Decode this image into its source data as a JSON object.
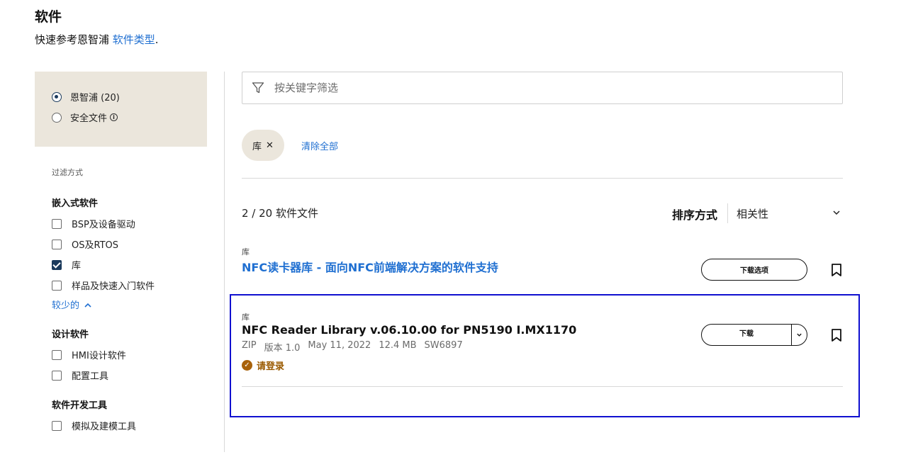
{
  "header": {
    "title": "软件",
    "subtitle_prefix": "快速参考恩智浦 ",
    "subtitle_link": "软件类型",
    "subtitle_suffix": "."
  },
  "source_filter": [
    {
      "label": "恩智浦 (20)",
      "checked": true
    },
    {
      "label": "安全文件",
      "checked": false,
      "info": "i"
    }
  ],
  "sidebar": {
    "filter_by": "过滤方式",
    "groups": [
      {
        "title": "嵌入式软件",
        "items": [
          {
            "label": "BSP及设备驱动",
            "checked": false
          },
          {
            "label": "OS及RTOS",
            "checked": false
          },
          {
            "label": "库",
            "checked": true
          },
          {
            "label": "样品及快速入门软件",
            "checked": false
          }
        ],
        "less": "较少的"
      },
      {
        "title": "设计软件",
        "items": [
          {
            "label": "HMI设计软件",
            "checked": false
          },
          {
            "label": "配置工具",
            "checked": false
          }
        ]
      },
      {
        "title": "软件开发工具",
        "items": [
          {
            "label": "模拟及建模工具",
            "checked": false
          }
        ]
      }
    ]
  },
  "search": {
    "placeholder": "按关键字筛选"
  },
  "active_filters": {
    "chip": "库",
    "clear_all": "清除全部"
  },
  "results": {
    "count": "2 / 20 软件文件",
    "sort_label": "排序方式",
    "sort_value": "相关性",
    "items": [
      {
        "type": "库",
        "title": "NFC读卡器库 - 面向NFC前端解决方案的软件支持",
        "button": "下载选项"
      },
      {
        "type": "库",
        "title": "NFC Reader Library v.06.10.00 for PN5190 I.MX1170",
        "meta": [
          "ZIP",
          "版本 1.0",
          "May 11, 2022",
          "12.4 MB",
          "SW6897"
        ],
        "login": "请登录",
        "button": "下载"
      }
    ]
  },
  "colors": {
    "accent": "#1f6fd1",
    "sidebar_bg": "#ebe6dc",
    "highlight": "#1010d0",
    "login": "#9a5a00"
  }
}
